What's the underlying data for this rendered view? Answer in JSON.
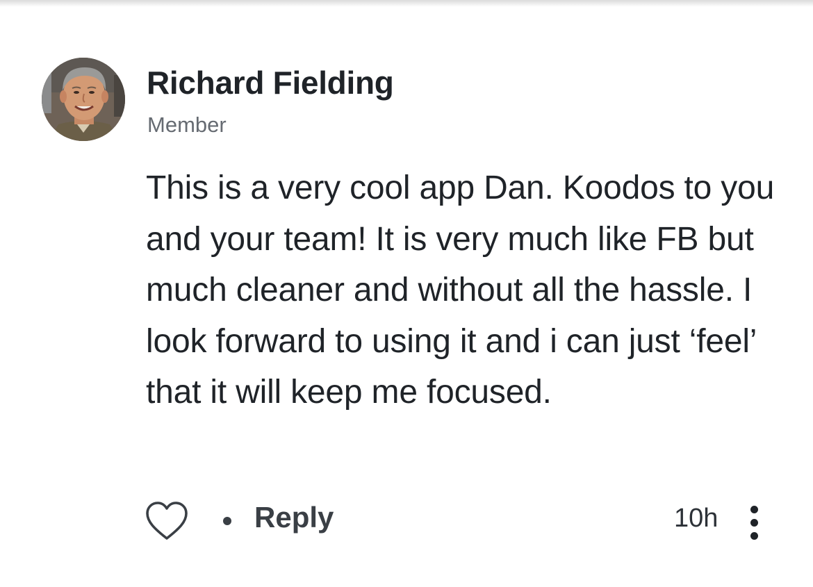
{
  "comment": {
    "author": "Richard Fielding",
    "role": "Member",
    "text": "This is a very cool app Dan. Koodos to you and your team! It is very much like FB but much cleaner and without all the hassle. I look forward to using it and i can just ‘feel’ that it will keep me focused.",
    "timestamp": "10h"
  },
  "actions": {
    "like_icon": "heart-outline-icon",
    "separator": "•",
    "reply_label": "Reply",
    "more_icon": "vertical-ellipsis-icon"
  },
  "colors": {
    "text_primary": "#1f2328",
    "text_secondary": "#666b72",
    "action_text": "#3a3f45",
    "background": "#ffffff"
  }
}
